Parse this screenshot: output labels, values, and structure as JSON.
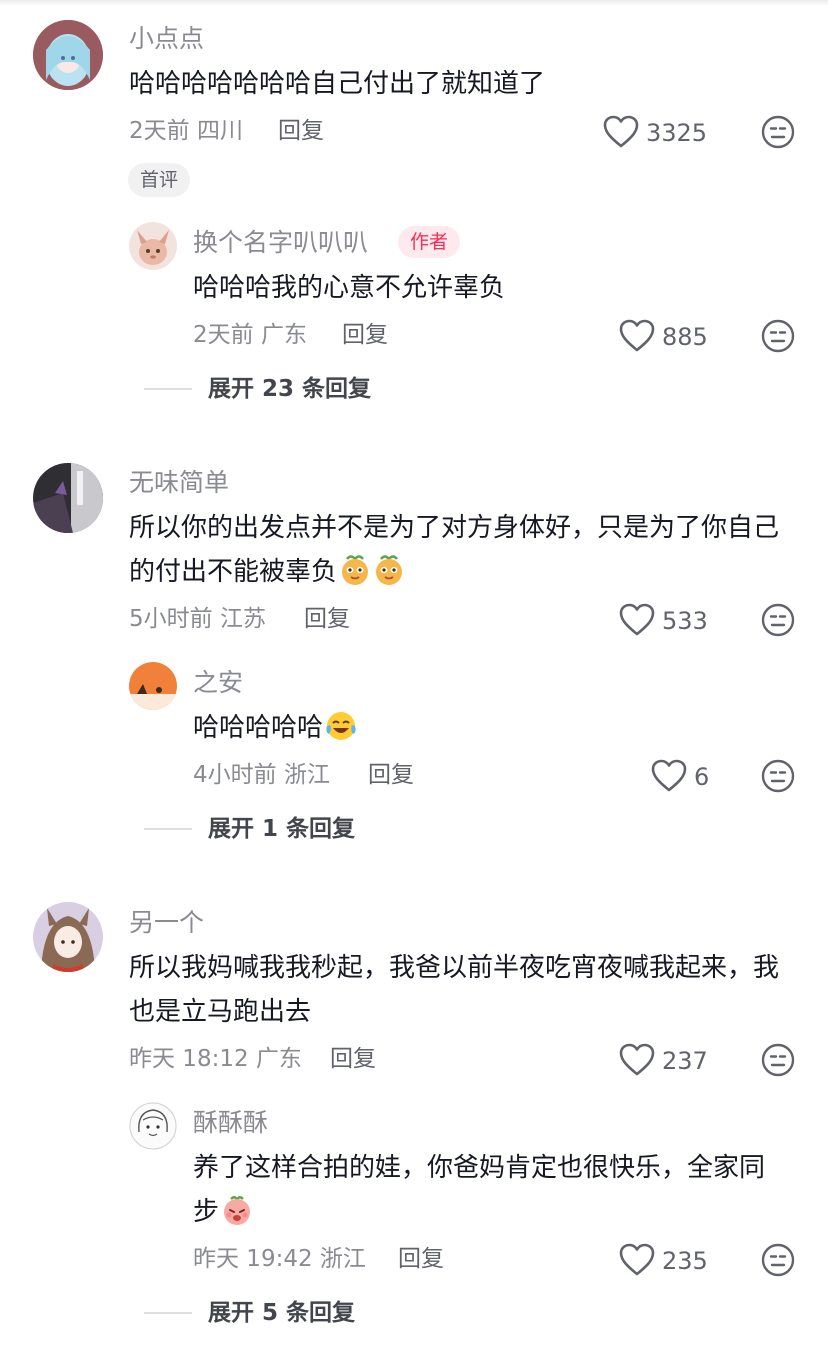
{
  "comments": [
    {
      "user": "小点点",
      "text": "哈哈哈哈哈哈哈自己付出了就知道了",
      "time_location": "2天前 四川",
      "reply_label": "回复",
      "likes": "3325",
      "tag": "首评",
      "replies": [
        {
          "user": "换个名字叭叭叭",
          "badge": "作者",
          "text": "哈哈哈我的心意不允许辜负",
          "time_location": "2天前 广东",
          "reply_label": "回复",
          "likes": "885"
        }
      ],
      "expand_label": "展开 23 条回复"
    },
    {
      "user": "无味简单",
      "text": "所以你的出发点并不是为了对方身体好，只是为了你自己的付出不能被辜负",
      "time_location": "5小时前 江苏",
      "reply_label": "回复",
      "likes": "533",
      "replies": [
        {
          "user": "之安",
          "text": "哈哈哈哈哈",
          "time_location": "4小时前 浙江",
          "reply_label": "回复",
          "likes": "6"
        }
      ],
      "expand_label": "展开 1 条回复"
    },
    {
      "user": "另一个",
      "text": "所以我妈喊我我秒起，我爸以前半夜吃宵夜喊我起来，我也是立马跑出去",
      "time_location": "昨天 18:12 广东",
      "reply_label": "回复",
      "likes": "237",
      "replies": [
        {
          "user": "酥酥酥",
          "text": "养了这样合拍的娃，你爸妈肯定也很快乐，全家同步",
          "time_location": "昨天 19:42 浙江",
          "reply_label": "回复",
          "likes": "235"
        }
      ],
      "expand_label": "展开 5 条回复"
    }
  ],
  "icons": {
    "like": "heart-outline-icon",
    "dislike": "neutral-face-icon",
    "emoji_1": "smug-face-emoji",
    "emoji_2": "laughing-tears-emoji",
    "emoji_3": "shy-face-emoji"
  },
  "colors": {
    "text_primary": "#161823",
    "text_secondary": "#8a8b91",
    "author_badge": "#fe2c55",
    "divider": "#dedee0"
  }
}
